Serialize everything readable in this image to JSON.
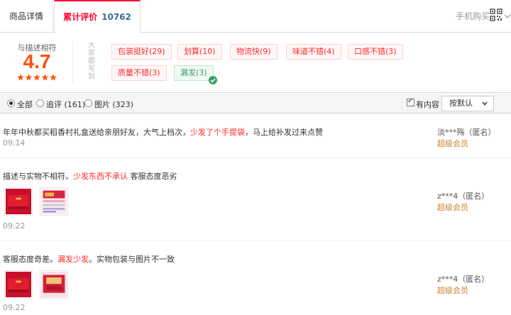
{
  "tabs": {
    "details_label": "商品详情",
    "reviews_label": "累计评价",
    "reviews_count": "10762",
    "mobile_buy": "手机购买"
  },
  "summary": {
    "score_label": "与描述相符",
    "score": "4.7",
    "stars": 4.7,
    "vertical_label": "大家都写到",
    "tags": [
      {
        "label": "包装挺好(29)",
        "tone": "positive"
      },
      {
        "label": "划算(10)",
        "tone": "positive"
      },
      {
        "label": "物流快(9)",
        "tone": "positive"
      },
      {
        "label": "味道不错(4)",
        "tone": "positive"
      },
      {
        "label": "口感不错(3)",
        "tone": "positive"
      },
      {
        "label": "质量不错(3)",
        "tone": "positive"
      },
      {
        "label": "漏发(3)",
        "tone": "negative",
        "selected": true
      }
    ]
  },
  "filters": {
    "all": "全部",
    "followup": "追评 (161)",
    "pictures": "图片 (323)",
    "has_content": "有内容",
    "sort": "按默认"
  },
  "reviews": [
    {
      "text_before": "年年中秋都买稻香村礼盒送给亲朋好友，大气上档次，",
      "text_highlight": "少发了个手提袋",
      "text_after": "，马上给补发过来点赞",
      "date": "09.14",
      "user": "淡***殇（匿名）",
      "level": "超级会员"
    },
    {
      "text_before": "描述与实物不相符。",
      "text_highlight": "少发东西不承认",
      "text_after": " 客服态度恶劣",
      "date": "09.22",
      "user": "z***4（匿名）",
      "level": "超级会员"
    },
    {
      "text_before": "客服态度奇差。",
      "text_highlight": "漏发少发",
      "text_after": "。实物包装与图片不一致",
      "date": "09.22",
      "user": "z***4（匿名）",
      "level": "超级会员"
    }
  ],
  "colors": {
    "accent": "#ff0036",
    "score": "#ff5000",
    "member": "#c8852f"
  }
}
